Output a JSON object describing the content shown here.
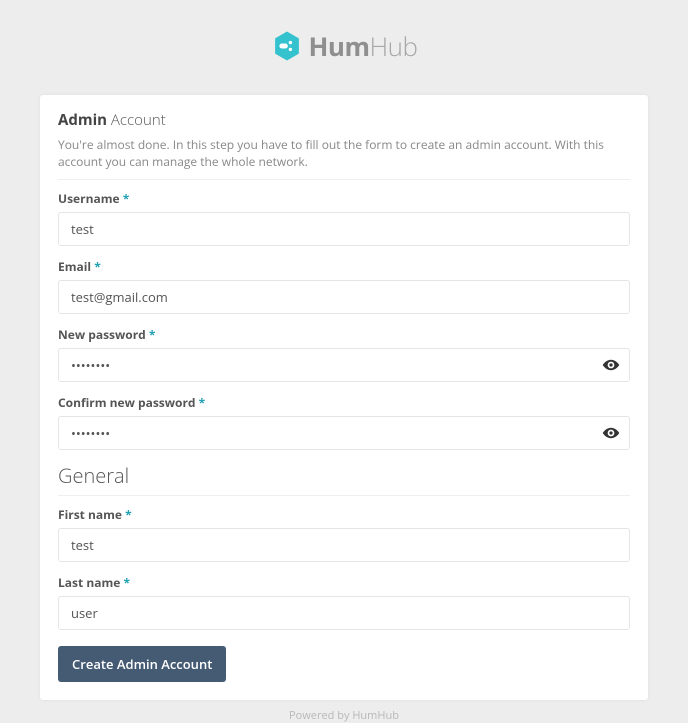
{
  "logo": {
    "bold": "Hum",
    "light": "Hub"
  },
  "heading": {
    "bold": "Admin",
    "light": "Account"
  },
  "description": "You're almost done. In this step you have to fill out the form to create an admin account. With this account you can manage the whole network.",
  "section_general": "General",
  "fields": {
    "username": {
      "label": "Username",
      "value": "test"
    },
    "email": {
      "label": "Email",
      "value": "test@gmail.com"
    },
    "password": {
      "label": "New password",
      "value": "••••••••"
    },
    "password2": {
      "label": "Confirm new password",
      "value": "••••••••"
    },
    "first_name": {
      "label": "First name",
      "value": "test"
    },
    "last_name": {
      "label": "Last name",
      "value": "user"
    }
  },
  "required_marker": "*",
  "submit_label": "Create Admin Account",
  "footer": "Powered by HumHub"
}
